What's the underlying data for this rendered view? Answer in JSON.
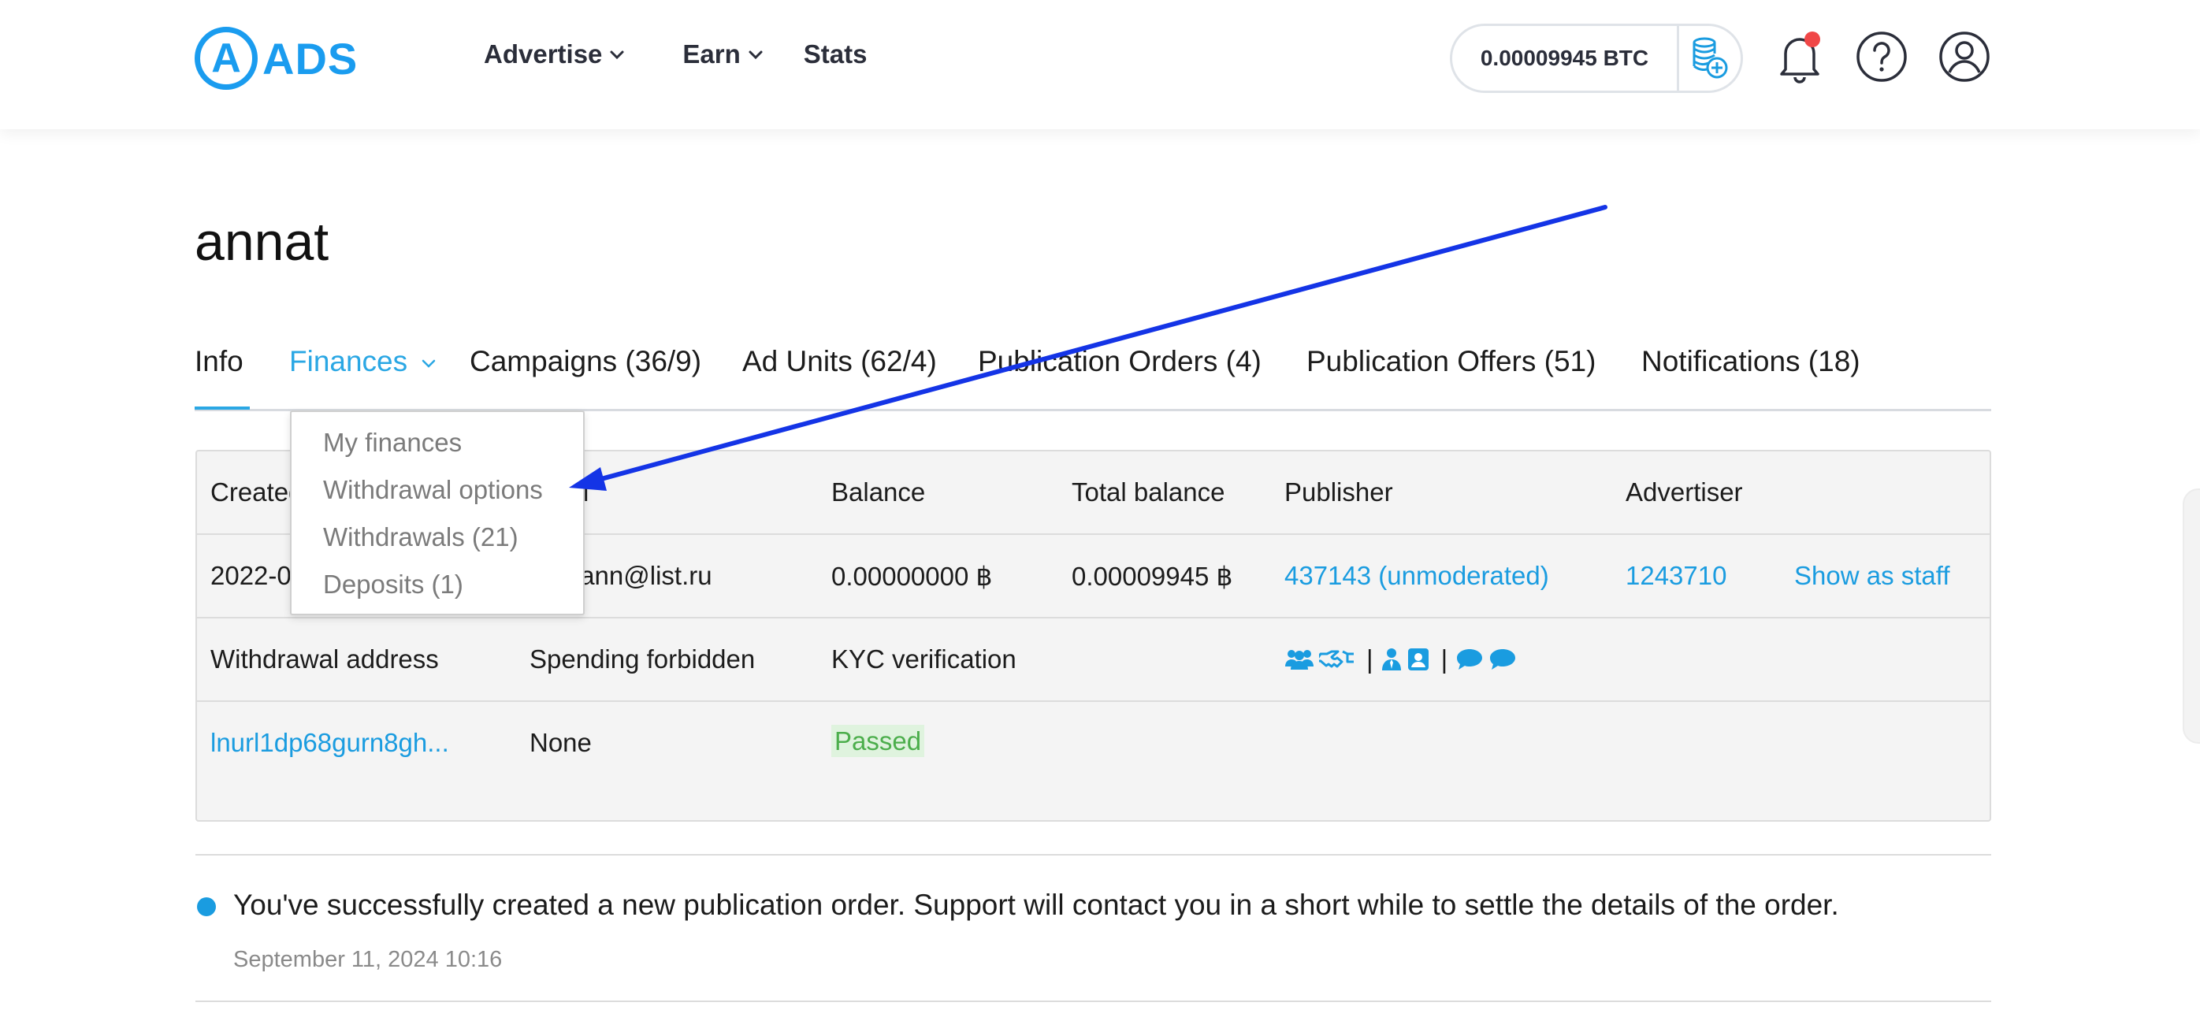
{
  "header": {
    "logo_text": "ADS",
    "logo_mark": "A",
    "nav": [
      {
        "label": "Advertise",
        "has_dropdown": true
      },
      {
        "label": "Earn",
        "has_dropdown": true
      },
      {
        "label": "Stats",
        "has_dropdown": false
      }
    ],
    "balance": "0.00009945  BTC",
    "icons": [
      "coins-add-icon",
      "bell-icon",
      "help-icon",
      "user-icon"
    ],
    "notification_dot_color": "#f04747"
  },
  "page": {
    "title": "annat",
    "tabs": [
      {
        "label": "Info",
        "active": false
      },
      {
        "label": "Finances",
        "active": true,
        "has_dropdown": true
      },
      {
        "label": "Campaigns (36/9)",
        "active": false
      },
      {
        "label": "Ad Units (62/4)",
        "active": false
      },
      {
        "label": "Publication Orders (4)",
        "active": false
      },
      {
        "label": "Publication Offers (51)",
        "active": false
      },
      {
        "label": "Notifications (18)",
        "active": false
      }
    ],
    "finances_menu": [
      "My finances",
      "Withdrawal options",
      "Withdrawals (21)",
      "Deposits (1)"
    ]
  },
  "table": {
    "header": {
      "created": "Created",
      "email_partial": "l",
      "balance": "Balance",
      "total_balance": "Total balance",
      "publisher": "Publisher",
      "advertiser": "Advertiser"
    },
    "row": {
      "created": "2022-0",
      "email": "novann@list.ru",
      "balance": "0.00000000 ฿",
      "total_balance": "0.00009945 ฿",
      "publisher": "437143 (unmoderated)",
      "advertiser": "1243710",
      "show_as_staff": "Show as staff"
    },
    "header2": {
      "withdrawal_address": "Withdrawal address",
      "spending_forbidden": "Spending forbidden",
      "kyc": "KYC verification"
    },
    "row2": {
      "withdrawal_address": "lnurl1dp68gurn8gh...",
      "spending_forbidden": "None",
      "kyc_status": "Passed"
    },
    "feature_icons": [
      "users-icon",
      "handshake-icon",
      "user-tie-icon",
      "contact-card-icon",
      "comment-icon",
      "comment-icon"
    ],
    "separator": "|"
  },
  "notification": {
    "text": "You've successfully created a new publication order. Support will contact you in a short while to settle the details of the order.",
    "date": "September 11, 2024 10:16"
  },
  "colors": {
    "accent": "#1a9ce0",
    "annotation_arrow": "#1434e6",
    "passed_bg": "#dff3de",
    "passed_text": "#4cae4c"
  }
}
